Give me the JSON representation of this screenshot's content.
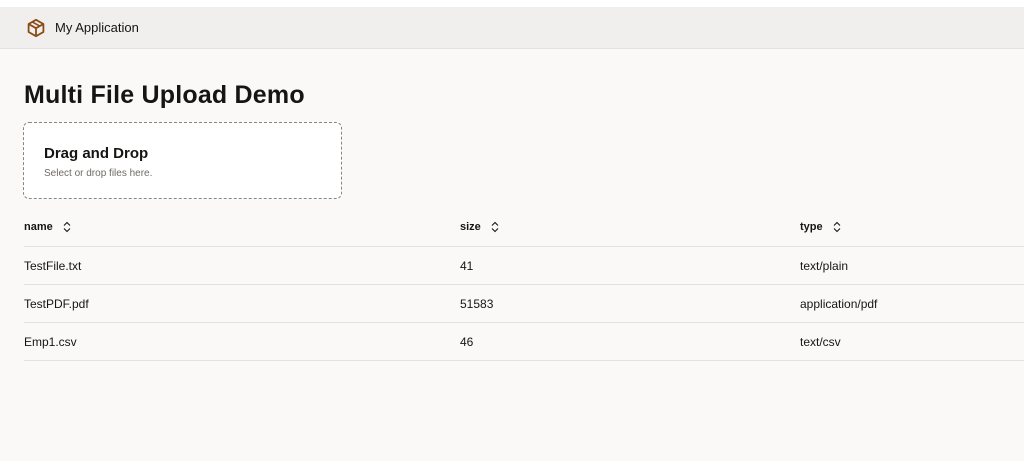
{
  "header": {
    "app_title": "My Application",
    "logo_icon": "cube-icon",
    "brand_color": "#8a4b13"
  },
  "page": {
    "title": "Multi File Upload Demo"
  },
  "dropzone": {
    "title": "Drag and Drop",
    "hint": "Select or drop files here."
  },
  "table": {
    "columns": [
      {
        "label": "name",
        "sort_icon": "sort-icon"
      },
      {
        "label": "size",
        "sort_icon": "sort-icon"
      },
      {
        "label": "type",
        "sort_icon": "sort-icon"
      }
    ],
    "rows": [
      {
        "name": "TestFile.txt",
        "size": "41",
        "type": "text/plain"
      },
      {
        "name": "TestPDF.pdf",
        "size": "51583",
        "type": "application/pdf"
      },
      {
        "name": "Emp1.csv",
        "size": "46",
        "type": "text/csv"
      }
    ]
  }
}
